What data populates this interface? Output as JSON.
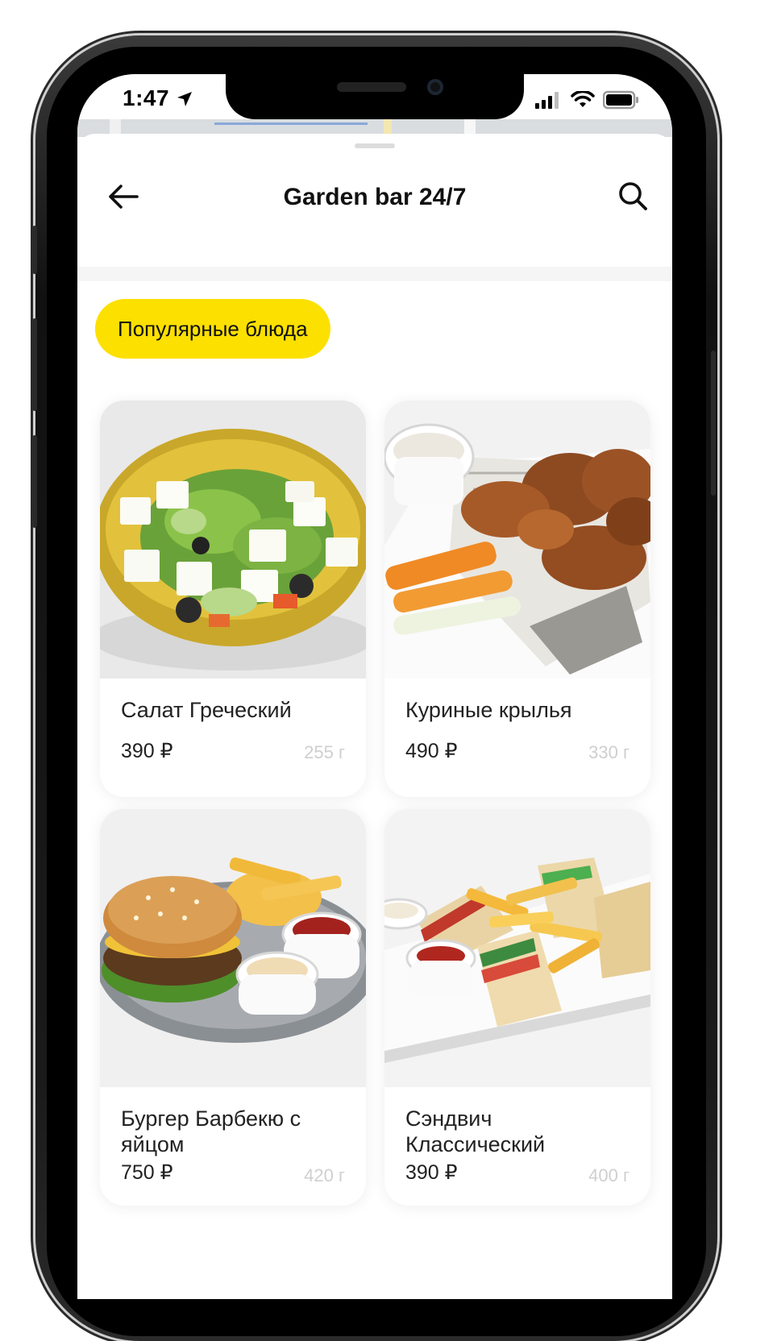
{
  "status_bar": {
    "time": "1:47"
  },
  "header": {
    "title": "Garden bar 24/7"
  },
  "category_chip": {
    "label": "Популярные блюда"
  },
  "menu_items": [
    {
      "name": "Салат Греческий",
      "price": "390 ₽",
      "weight": "255 г"
    },
    {
      "name": "Куриные крылья",
      "price": "490 ₽",
      "weight": "330 г"
    },
    {
      "name": "Бургер Барбекю с яйцом",
      "price": "750 ₽",
      "weight": "420 г"
    },
    {
      "name": "Сэндвич Классический",
      "price": "390 ₽",
      "weight": "400 г"
    }
  ],
  "icons": {
    "back": "arrow-left-icon",
    "search": "search-icon",
    "location": "location-arrow-icon",
    "signal": "cellular-signal-icon",
    "wifi": "wifi-icon",
    "battery": "battery-icon"
  },
  "colors": {
    "accent": "#fce000",
    "text": "#111111",
    "weight_text": "#cfcfcf"
  }
}
